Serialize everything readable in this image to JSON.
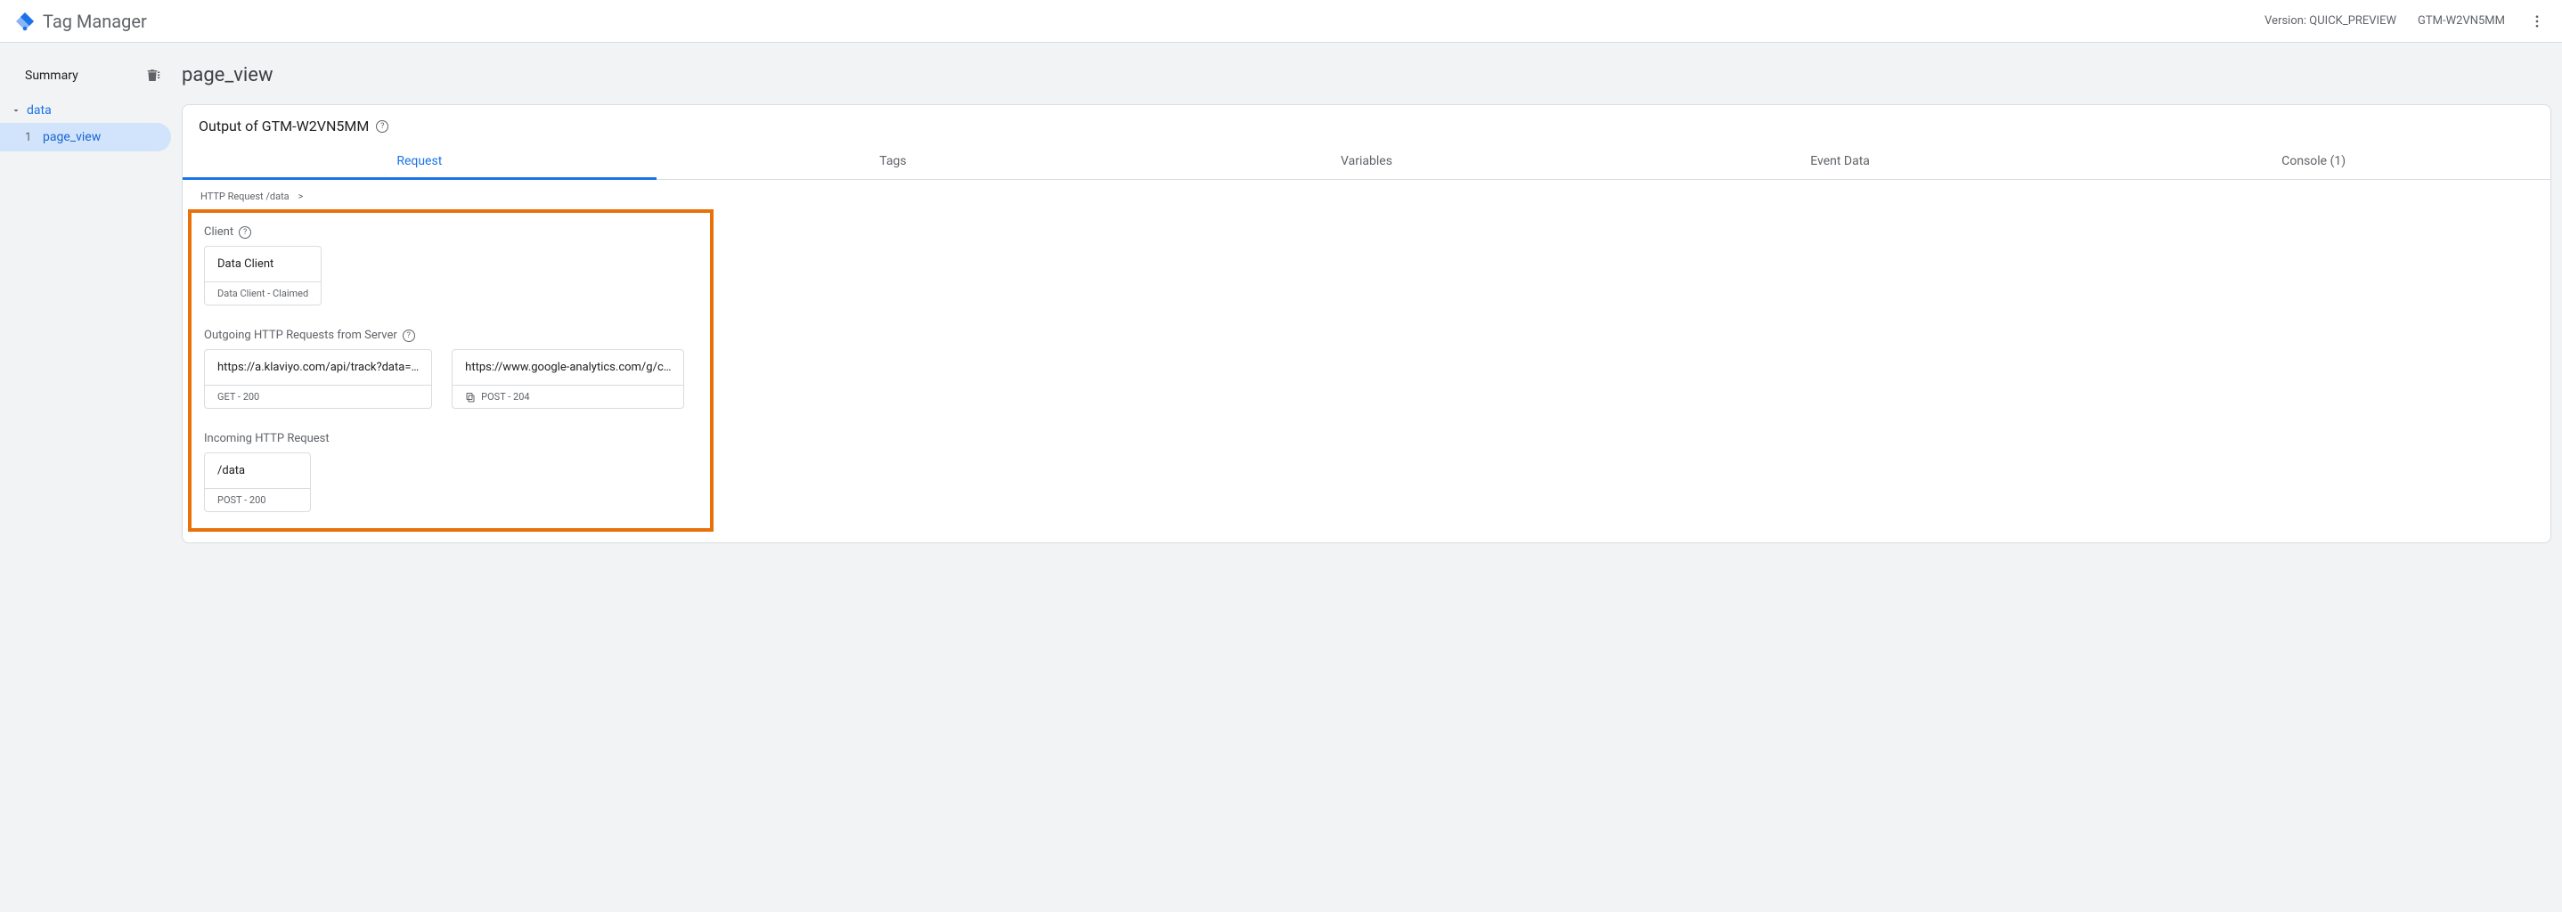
{
  "header": {
    "app_title": "Tag Manager",
    "version_label": "Version: QUICK_PREVIEW",
    "container_id": "GTM-W2VN5MM"
  },
  "sidebar": {
    "summary_label": "Summary",
    "group_label": "data",
    "items": [
      {
        "num": "1",
        "label": "page_view"
      }
    ]
  },
  "main": {
    "page_title": "page_view",
    "output_label": "Output of GTM-W2VN5MM",
    "tabs": [
      {
        "label": "Request",
        "active": true
      },
      {
        "label": "Tags"
      },
      {
        "label": "Variables"
      },
      {
        "label": "Event Data"
      },
      {
        "label": "Console (1)"
      }
    ],
    "breadcrumb": {
      "path": "HTTP Request /data",
      "sep": ">"
    },
    "client": {
      "section_label": "Client",
      "name": "Data Client",
      "status": "Data Client - Claimed"
    },
    "outgoing": {
      "section_label": "Outgoing HTTP Requests from Server",
      "requests": [
        {
          "url": "https://a.klaviyo.com/api/track?data=…",
          "status": "GET - 200",
          "has_copy": false
        },
        {
          "url": "https://www.google-analytics.com/g/c…",
          "status": "POST - 204",
          "has_copy": true
        }
      ]
    },
    "incoming": {
      "section_label": "Incoming HTTP Request",
      "path": "/data",
      "status": "POST - 200"
    }
  }
}
